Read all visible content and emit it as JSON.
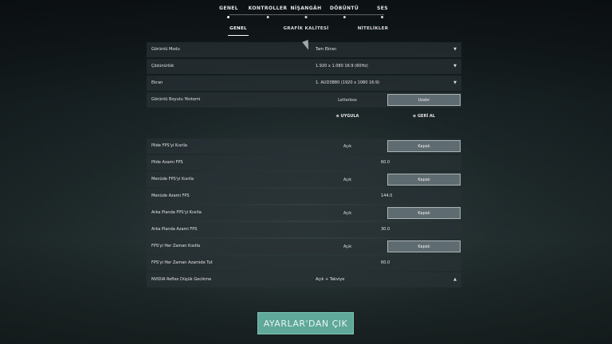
{
  "top_tabs": [
    {
      "label": "GENEL"
    },
    {
      "label": "KONTROLLER"
    },
    {
      "label": "NİŞANGÂH"
    },
    {
      "label": "DÖBÜNTÜ"
    },
    {
      "label": "SES"
    }
  ],
  "sub_tabs": [
    {
      "label": "GENEL"
    },
    {
      "label": "GRAFİK KALİTESİ"
    },
    {
      "label": "NİTELİKLER"
    }
  ],
  "display": {
    "mode_label": "Görüntü Modu",
    "mode_value": "Tam Ekran",
    "resolution_label": "Çözünürlük",
    "resolution_value": "1.920 x 1.080 16:9 (60Hz)",
    "screen_label": "Ekran",
    "screen_value": "1. AUD3B80 (1920 x 1080 16:9)",
    "aspect_label": "Görüntü Boyutu Yöntemi",
    "aspect_opt1": "Letterbox",
    "aspect_opt2": "Uzatır"
  },
  "actions": {
    "apply": "⊗ UYGULA",
    "revert": "⊗ GERİ AL"
  },
  "fps": {
    "battery_limit_label": "Pilde FPS'yi Kısıtla",
    "on": "Açık",
    "off": "Kapalı",
    "battery_max_label": "Pilde Azami FPS",
    "battery_max_value": "60.0",
    "menu_limit_label": "Menüde FPS'yi Kısıtla",
    "menu_max_label": "Menüde Azami FPS",
    "menu_max_value": "144.0",
    "bg_limit_label": "Arka Planda FPS'yi Kısıtla",
    "bg_max_label": "Arka Planda Azami FPS",
    "bg_max_value": "30.0",
    "always_limit_label": "FPS'yi Her Zaman Kısıtla",
    "always_max_label": "FPS'yi Her Zaman Azamide Tut",
    "always_max_value": "60.0"
  },
  "nvidia": {
    "label": "NVIDIA Reflex Düşük Gecikme",
    "value": "Açık + Takviye"
  },
  "exit_button": "AYARLAR'DAN ÇIK"
}
